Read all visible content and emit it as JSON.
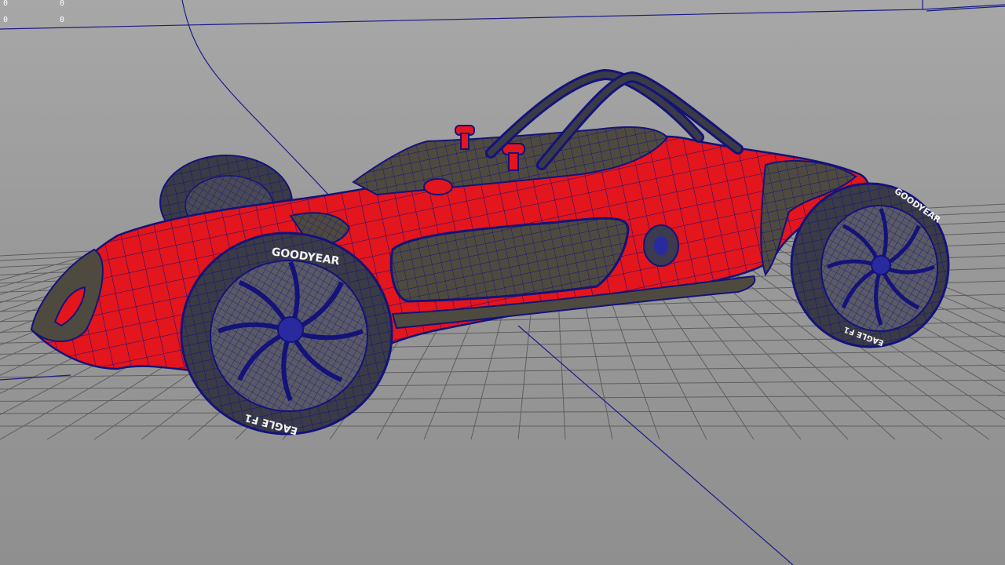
{
  "viewport": {
    "hud_readouts": [
      "0",
      "0",
      "0",
      "0"
    ]
  },
  "model": {
    "body_color": "#e3151d",
    "panel_color": "#4f4a40",
    "wire_color": "#14137a",
    "tire_color": "#3a3b46",
    "tire_brand": "GOODYEAR",
    "tire_model": "EAGLE F1"
  },
  "scene_colors": {
    "background": "#9d9d9d",
    "grid": "#5e5e5e",
    "axis": "#1b1b8a"
  }
}
